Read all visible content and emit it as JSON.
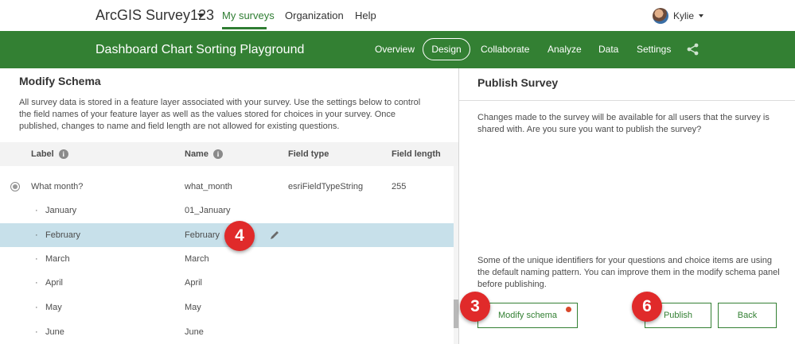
{
  "topbar": {
    "brand": "ArcGIS Survey123",
    "nav": [
      "My surveys",
      "Organization",
      "Help"
    ],
    "user": "Kylie"
  },
  "header": {
    "survey_title": "Dashboard Chart Sorting Playground",
    "nav": [
      "Overview",
      "Design",
      "Collaborate",
      "Analyze",
      "Data",
      "Settings"
    ],
    "active_tab": "Design"
  },
  "schema": {
    "title": "Modify Schema",
    "description": "All survey data is stored in a feature layer associated with your survey. Use the settings below to control the field names of your feature layer as well as the values stored for choices in your survey. Once published, changes to name and field length are not allowed for existing questions.",
    "columns": [
      "Label",
      "Name",
      "Field type",
      "Field length"
    ],
    "question": {
      "label": "What month?",
      "name": "what_month",
      "field_type": "esriFieldTypeString",
      "field_length": "255"
    },
    "choices": [
      {
        "label": "January",
        "name": "01_January"
      },
      {
        "label": "February",
        "name": "February"
      },
      {
        "label": "March",
        "name": "March"
      },
      {
        "label": "April",
        "name": "April"
      },
      {
        "label": "May",
        "name": "May"
      },
      {
        "label": "June",
        "name": "June"
      }
    ]
  },
  "publish": {
    "title": "Publish Survey",
    "message": "Changes made to the survey will be available for all users that the survey is shared with. Are you sure you want to publish the survey?",
    "note": "Some of the unique identifiers for your questions and choice items are using the default naming pattern. You can improve them in the modify schema panel before publishing.",
    "modify_button": "Modify schema",
    "publish_button": "Publish",
    "back_button": "Back"
  },
  "badges": [
    "4",
    "3",
    "6"
  ],
  "colors": {
    "brand_green": "#338033",
    "selected_row": "#c7e0ea",
    "badge_red": "#e02a2a",
    "notification_dot": "#d9482b"
  }
}
